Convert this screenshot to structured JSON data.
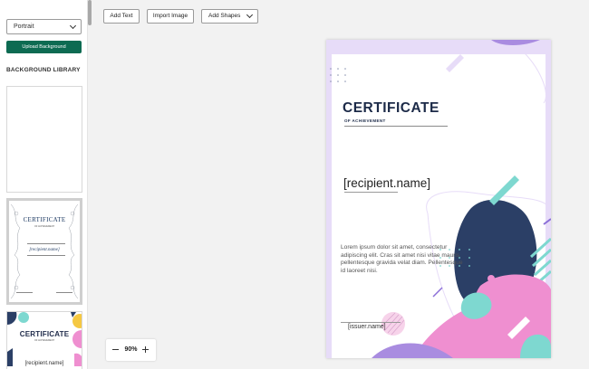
{
  "sidebar": {
    "orientation_select": {
      "value": "Portrait"
    },
    "upload_button": {
      "label": "Upload Background"
    },
    "library_title": "BACKGROUND LIBRARY",
    "thumbnails": [
      {
        "title": "",
        "subtitle": "",
        "recipient": ""
      },
      {
        "title": "CERTIFICATE",
        "subtitle": "OF ACHIEVEMENT",
        "recipient": "[recipient.name]"
      },
      {
        "title": "CERTIFICATE",
        "subtitle": "OF ACHIEVEMENT",
        "recipient": "[recipient.name]"
      }
    ]
  },
  "toolbar": {
    "add_text": "Add Text",
    "import_image": "Import Image",
    "add_shapes": "Add Shapes"
  },
  "zoom": {
    "value": "90%"
  },
  "certificate": {
    "title": "CERTIFICATE",
    "subtitle": "OF ACHIEVEMENT",
    "recipient": "[recipient.name]",
    "body": "Lorem ipsum dolor sit amet, consectetur adipiscing elit. Cras sit amet nisi vitae mauris pellentesque gravida velat diam. Pellentesque id laoreet nisi.",
    "issuer": "[issuer.name]"
  },
  "colors": {
    "upload_button": "#0d6b52",
    "cert_border": "#e7dcf8",
    "navy": "#2b3f66",
    "teal": "#7ed8d0",
    "pink": "#ef8fd0"
  },
  "icons": {
    "orientation_select": "chevron-down-icon",
    "add_shapes": "chevron-down-icon",
    "zoom_out": "minus-icon",
    "zoom_in": "plus-icon"
  }
}
